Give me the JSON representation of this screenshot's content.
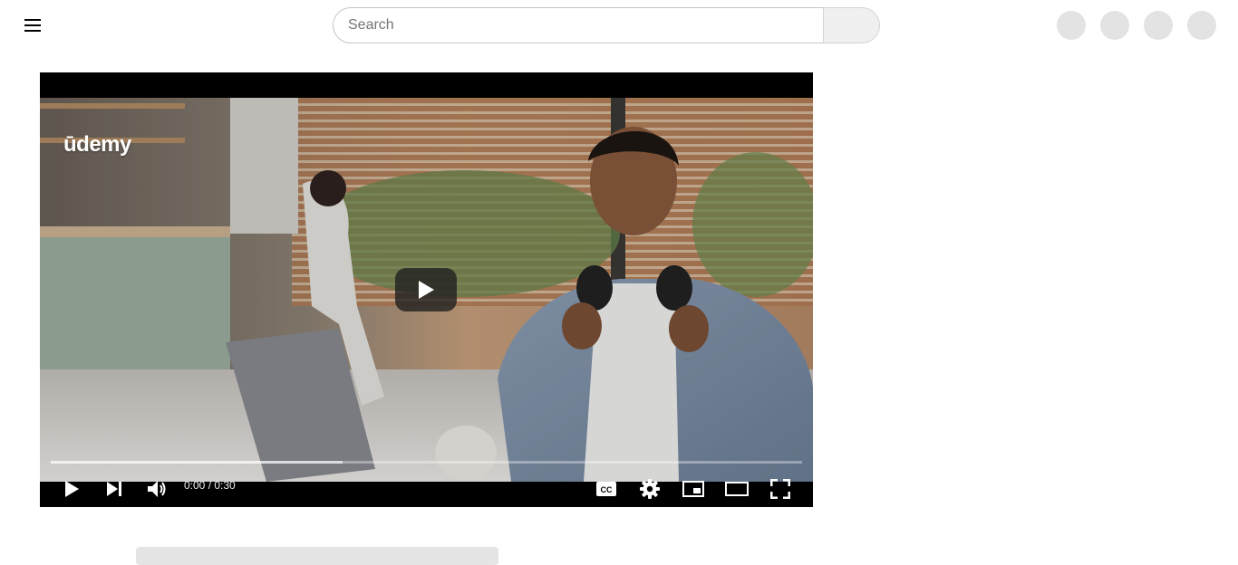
{
  "header": {
    "search": {
      "value": "",
      "placeholder": "Search"
    },
    "icons": {
      "menu": "hamburger-menu-icon",
      "search_button": "search-button-icon",
      "actions": [
        "header-action-1",
        "header-action-2",
        "header-action-3",
        "header-action-4"
      ]
    }
  },
  "player": {
    "brand_logo": "ūdemy",
    "time": {
      "current": "0:00",
      "separator": " / ",
      "duration": "0:30",
      "display": "0:00 / 0:30"
    },
    "progress": {
      "played_fraction": 0,
      "buffered_fraction": 0.388
    },
    "controls": {
      "left": [
        "play-icon",
        "next-icon",
        "volume-icon"
      ],
      "right": [
        "captions-icon",
        "settings-icon",
        "miniplayer-icon",
        "theater-mode-icon",
        "fullscreen-icon"
      ]
    }
  },
  "colors": {
    "player_background": "#000000",
    "search_border": "#c6c6c6",
    "placeholder_circles": "#e3e3e3"
  }
}
